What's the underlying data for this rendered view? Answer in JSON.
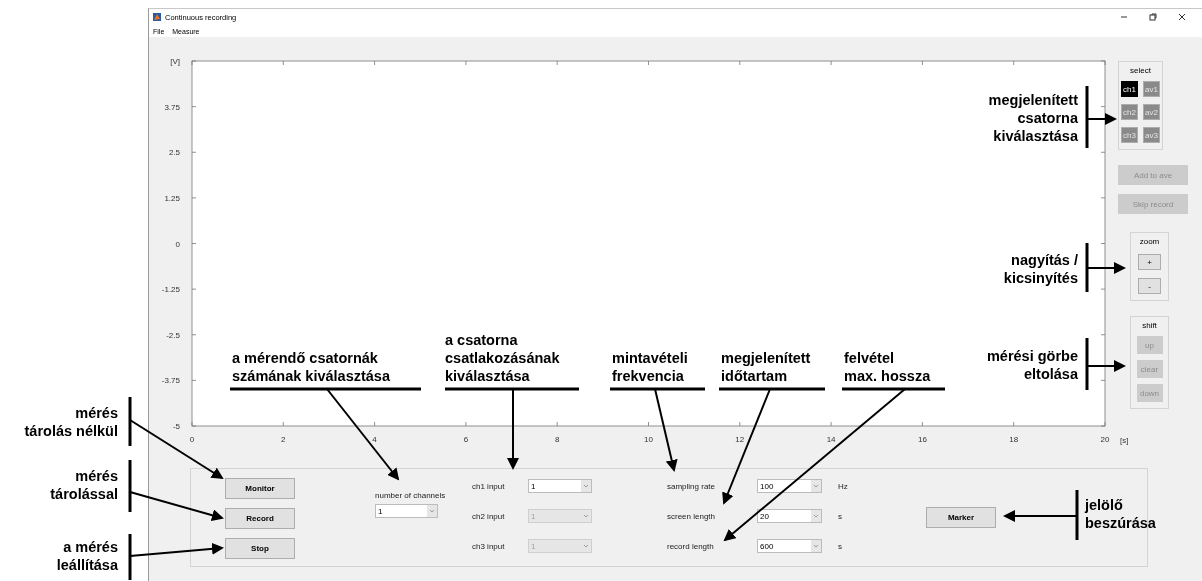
{
  "window": {
    "title": "Continuous recording"
  },
  "menu": [
    "File",
    "Measure"
  ],
  "plot": {
    "chart_data": {
      "type": "line",
      "xlabel": "[s]",
      "xlim": [
        0,
        20
      ],
      "ylim": [
        -5,
        5
      ],
      "xticks": [
        0,
        2,
        4,
        6,
        8,
        10,
        12,
        14,
        16,
        18,
        20
      ],
      "yticks": [
        -5,
        -3.75,
        -2.5,
        -1.25,
        0,
        1.25,
        2.5,
        3.75,
        {
          "value": 5,
          "label": "[V]"
        }
      ]
    }
  },
  "select_group": {
    "title": "select",
    "buttons": [
      {
        "label": "ch1",
        "selected": true,
        "disabled": false
      },
      {
        "label": "av1",
        "selected": false,
        "disabled": true
      },
      {
        "label": "ch2",
        "selected": false,
        "disabled": true
      },
      {
        "label": "av2",
        "selected": false,
        "disabled": true
      },
      {
        "label": "ch3",
        "selected": false,
        "disabled": true
      },
      {
        "label": "av3",
        "selected": false,
        "disabled": true
      }
    ]
  },
  "record_buttons": [
    {
      "label": "Add to ave",
      "disabled": true
    },
    {
      "label": "Skip record",
      "disabled": true
    }
  ],
  "zoom_group": {
    "title": "zoom",
    "buttons": [
      {
        "label": "+",
        "disabled": false
      },
      {
        "label": "-",
        "disabled": false
      }
    ]
  },
  "shift_group": {
    "title": "shift",
    "buttons": [
      {
        "label": "up",
        "disabled": true
      },
      {
        "label": "clear",
        "disabled": true
      },
      {
        "label": "down",
        "disabled": true
      }
    ]
  },
  "control_panel": {
    "run_buttons": [
      "Monitor",
      "Record",
      "Stop"
    ],
    "channel_count": {
      "label": "number of channels",
      "value": "1",
      "disabled": false
    },
    "inputs": [
      {
        "label": "ch1 input",
        "value": "1",
        "disabled": false
      },
      {
        "label": "ch2 input",
        "value": "1",
        "disabled": true
      },
      {
        "label": "ch3 input",
        "value": "1",
        "disabled": true
      }
    ],
    "settings": [
      {
        "label": "sampling rate",
        "value": "100",
        "unit": "Hz"
      },
      {
        "label": "screen length",
        "value": "20",
        "unit": "s"
      },
      {
        "label": "record length",
        "value": "600",
        "unit": "s"
      }
    ],
    "marker_button": "Marker"
  },
  "annotations": [
    {
      "lines": [
        "megjelenített",
        "csatorna",
        "kiválasztása"
      ]
    },
    {
      "lines": [
        "nagyítás /",
        "kicsinyítés"
      ]
    },
    {
      "lines": [
        "mérési görbe",
        "eltolása"
      ]
    },
    {
      "lines": [
        "jelölő",
        "beszúrása"
      ]
    },
    {
      "lines": [
        "mérés",
        "tárolás nélkül"
      ]
    },
    {
      "lines": [
        "mérés",
        "tárolással"
      ]
    },
    {
      "lines": [
        "a mérés",
        "leállítása"
      ]
    },
    {
      "lines": [
        "a mérendő csatornák",
        "számának kiválasztása"
      ]
    },
    {
      "lines": [
        "a csatorna",
        "csatlakozásának",
        "kiválasztása"
      ]
    },
    {
      "lines": [
        "mintavételi",
        "frekvencia"
      ]
    },
    {
      "lines": [
        "megjelenített",
        "időtartam"
      ]
    },
    {
      "lines": [
        "felvétel",
        "max. hossza"
      ]
    }
  ]
}
